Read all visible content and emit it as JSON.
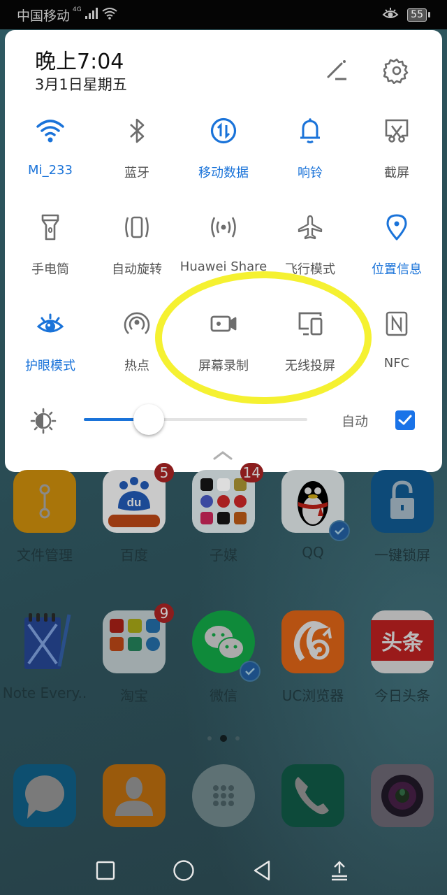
{
  "status_bar": {
    "carrier": "中国移动",
    "network_type": "4G",
    "battery_level": "55",
    "icons": [
      "signal-icon",
      "wifi-icon",
      "eye-comfort-icon",
      "battery-icon"
    ]
  },
  "panel": {
    "time": "晚上7:04",
    "date": "3月1日星期五",
    "edit_icon": "edit-icon",
    "settings_icon": "gear-icon"
  },
  "toggles": [
    {
      "id": "wifi",
      "label": "Mi_233",
      "icon": "wifi-icon",
      "active": true
    },
    {
      "id": "bluetooth",
      "label": "蓝牙",
      "icon": "bluetooth-icon",
      "active": false
    },
    {
      "id": "mobile-data",
      "label": "移动数据",
      "icon": "mobile-data-icon",
      "active": true
    },
    {
      "id": "ring",
      "label": "响铃",
      "icon": "bell-icon",
      "active": true
    },
    {
      "id": "screenshot",
      "label": "截屏",
      "icon": "screenshot-icon",
      "active": false
    },
    {
      "id": "flashlight",
      "label": "手电筒",
      "icon": "flashlight-icon",
      "active": false
    },
    {
      "id": "auto-rotate",
      "label": "自动旋转",
      "icon": "rotate-icon",
      "active": false
    },
    {
      "id": "huawei-share",
      "label": "Huawei Share",
      "icon": "huawei-share-icon",
      "active": false
    },
    {
      "id": "airplane",
      "label": "飞行模式",
      "icon": "airplane-icon",
      "active": false
    },
    {
      "id": "location",
      "label": "位置信息",
      "icon": "location-pin-icon",
      "active": true
    },
    {
      "id": "eye-comfort",
      "label": "护眼模式",
      "icon": "eye-icon",
      "active": true
    },
    {
      "id": "hotspot",
      "label": "热点",
      "icon": "hotspot-icon",
      "active": false
    },
    {
      "id": "screen-record",
      "label": "屏幕录制",
      "icon": "video-camera-icon",
      "active": false
    },
    {
      "id": "wireless-projection",
      "label": "无线投屏",
      "icon": "cast-devices-icon",
      "active": false
    },
    {
      "id": "nfc",
      "label": "NFC",
      "icon": "nfc-icon",
      "active": false
    }
  ],
  "brightness": {
    "level_percent": 29,
    "auto_label": "自动",
    "auto_checked": true
  },
  "home": {
    "row1": [
      {
        "label": "文件管理",
        "badge": null,
        "color": "#a9750a"
      },
      {
        "label": "百度",
        "badge": "5",
        "color": "#c9c9c9"
      },
      {
        "label": "子媒",
        "badge": "14",
        "color": "#b9c2c4"
      },
      {
        "label": "QQ",
        "badge": null,
        "color": "#b9bfc0"
      },
      {
        "label": "一键锁屏",
        "badge": null,
        "color": "#0d4a78"
      }
    ],
    "row2": [
      {
        "label": "Note Every..",
        "badge": null,
        "color": "transparent"
      },
      {
        "label": "淘宝",
        "badge": "9",
        "color": "#9fa9ab"
      },
      {
        "label": "微信",
        "badge": null,
        "color": "#0f8a3a"
      },
      {
        "label": "UC浏览器",
        "badge": null,
        "color": "#b65212"
      },
      {
        "label": "今日头条",
        "badge": null,
        "color": "#b2b2b2"
      }
    ],
    "page_indicator": {
      "pages": 3,
      "current": 2
    },
    "dock": [
      {
        "name": "messages",
        "color": "#0d4f70"
      },
      {
        "name": "contacts",
        "color": "#9a5a0c"
      },
      {
        "name": "app-drawer",
        "color": "#5e7174"
      },
      {
        "name": "phone",
        "color": "#0d4a3a"
      },
      {
        "name": "camera",
        "color": "#59555f"
      }
    ]
  },
  "nav": {
    "buttons": [
      "recents",
      "home",
      "back",
      "notification-pull"
    ]
  },
  "colors": {
    "accent": "#1a73d9",
    "inactive": "#666666",
    "annotation": "#f4f020"
  }
}
